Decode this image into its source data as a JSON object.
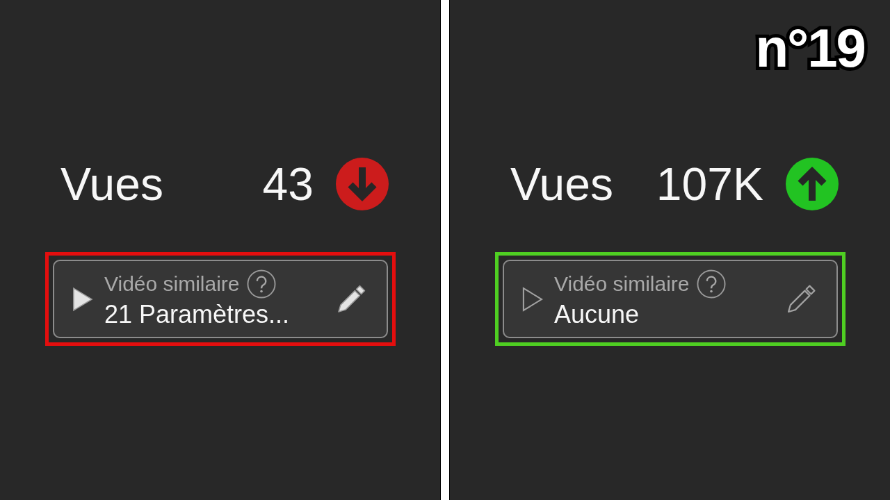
{
  "badge": "n°19",
  "panels": [
    {
      "color": "#e40e0e",
      "metric": {
        "label": "Vues",
        "value": "43",
        "trend": {
          "rising": false,
          "color": "#cc1c1c"
        }
      },
      "field": {
        "kind": "filled",
        "label": "Vidéo similaire",
        "value": "21 Paramètres..."
      }
    },
    {
      "color": "#4fcf22",
      "metric": {
        "label": "Vues",
        "value": "107K",
        "trend": {
          "rising": true,
          "color": "#22c322"
        }
      },
      "field": {
        "kind": "outline",
        "label": "Vidéo similaire",
        "value": "Aucune"
      }
    }
  ]
}
